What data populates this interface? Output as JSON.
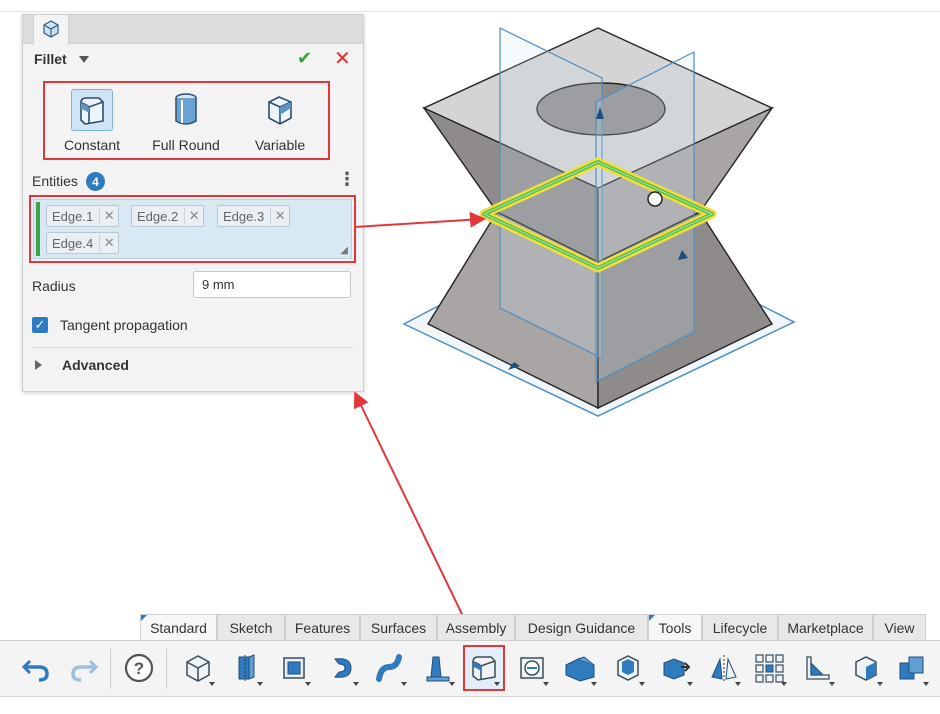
{
  "dialog": {
    "title": "Fillet",
    "types": [
      {
        "label": "Constant",
        "selected": true
      },
      {
        "label": "Full Round",
        "selected": false
      },
      {
        "label": "Variable",
        "selected": false
      }
    ],
    "entities_label": "Entities",
    "entities_count": "4",
    "edges": [
      "Edge.1",
      "Edge.2",
      "Edge.3",
      "Edge.4"
    ],
    "radius_label": "Radius",
    "radius_value": "9 mm",
    "tangent_label": "Tangent propagation",
    "tangent_checked": true,
    "advanced_label": "Advanced"
  },
  "tabs": [
    "Standard",
    "Sketch",
    "Features",
    "Surfaces",
    "Assembly",
    "Design Guidance",
    "Tools",
    "Lifecycle",
    "Marketplace",
    "View"
  ],
  "toolbar_tools": [
    "undo-icon",
    "redo-icon",
    "help-icon",
    "new-part-icon",
    "extrude-icon",
    "shell-icon",
    "revolve-icon",
    "sweep-icon",
    "draft-icon",
    "fillet-icon",
    "hole-icon",
    "chamfer-icon",
    "face-blend-icon",
    "move-face-icon",
    "mirror-icon",
    "pattern-icon",
    "rib-icon",
    "wrap-icon",
    "boolean-icon"
  ],
  "colors": {
    "accent": "#2f7bbf",
    "highlight": "#e2373a",
    "selection": "#f2dd3a",
    "edge_green": "#5cc24a"
  }
}
